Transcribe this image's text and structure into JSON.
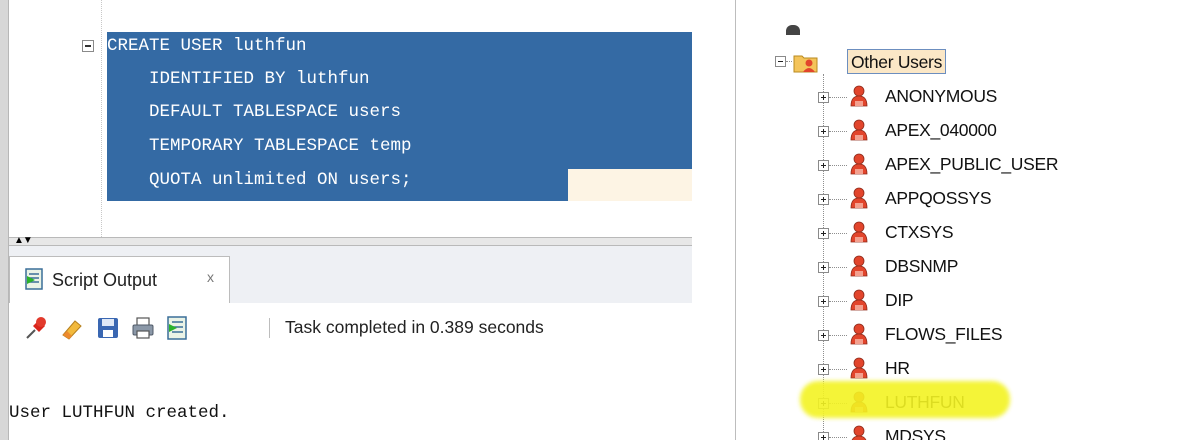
{
  "editor": {
    "code_lines": [
      "CREATE USER luthfun",
      "    IDENTIFIED BY luthfun",
      "    DEFAULT TABLESPACE users",
      "    TEMPORARY TABLESPACE temp",
      "    QUOTA unlimited ON users;"
    ]
  },
  "output_panel": {
    "tab_label": "Script Output",
    "tab_close": "x",
    "status": "Task completed in 0.389 seconds",
    "toolbar_icons": [
      "pin-icon",
      "eraser-icon",
      "save-icon",
      "print-icon",
      "open-script-icon"
    ],
    "output_text": "User LUTHFUN created."
  },
  "tree": {
    "parent_label": "Other Users",
    "users": [
      "ANONYMOUS",
      "APEX_040000",
      "APEX_PUBLIC_USER",
      "APPQOSSYS",
      "CTXSYS",
      "DBSNMP",
      "DIP",
      "FLOWS_FILES",
      "HR",
      "LUTHFUN",
      "MDSYS"
    ],
    "highlighted_user": "LUTHFUN"
  },
  "colors": {
    "selection": "#346aa4",
    "highlight": "#f3f323",
    "user_icon": "#e2452c"
  }
}
